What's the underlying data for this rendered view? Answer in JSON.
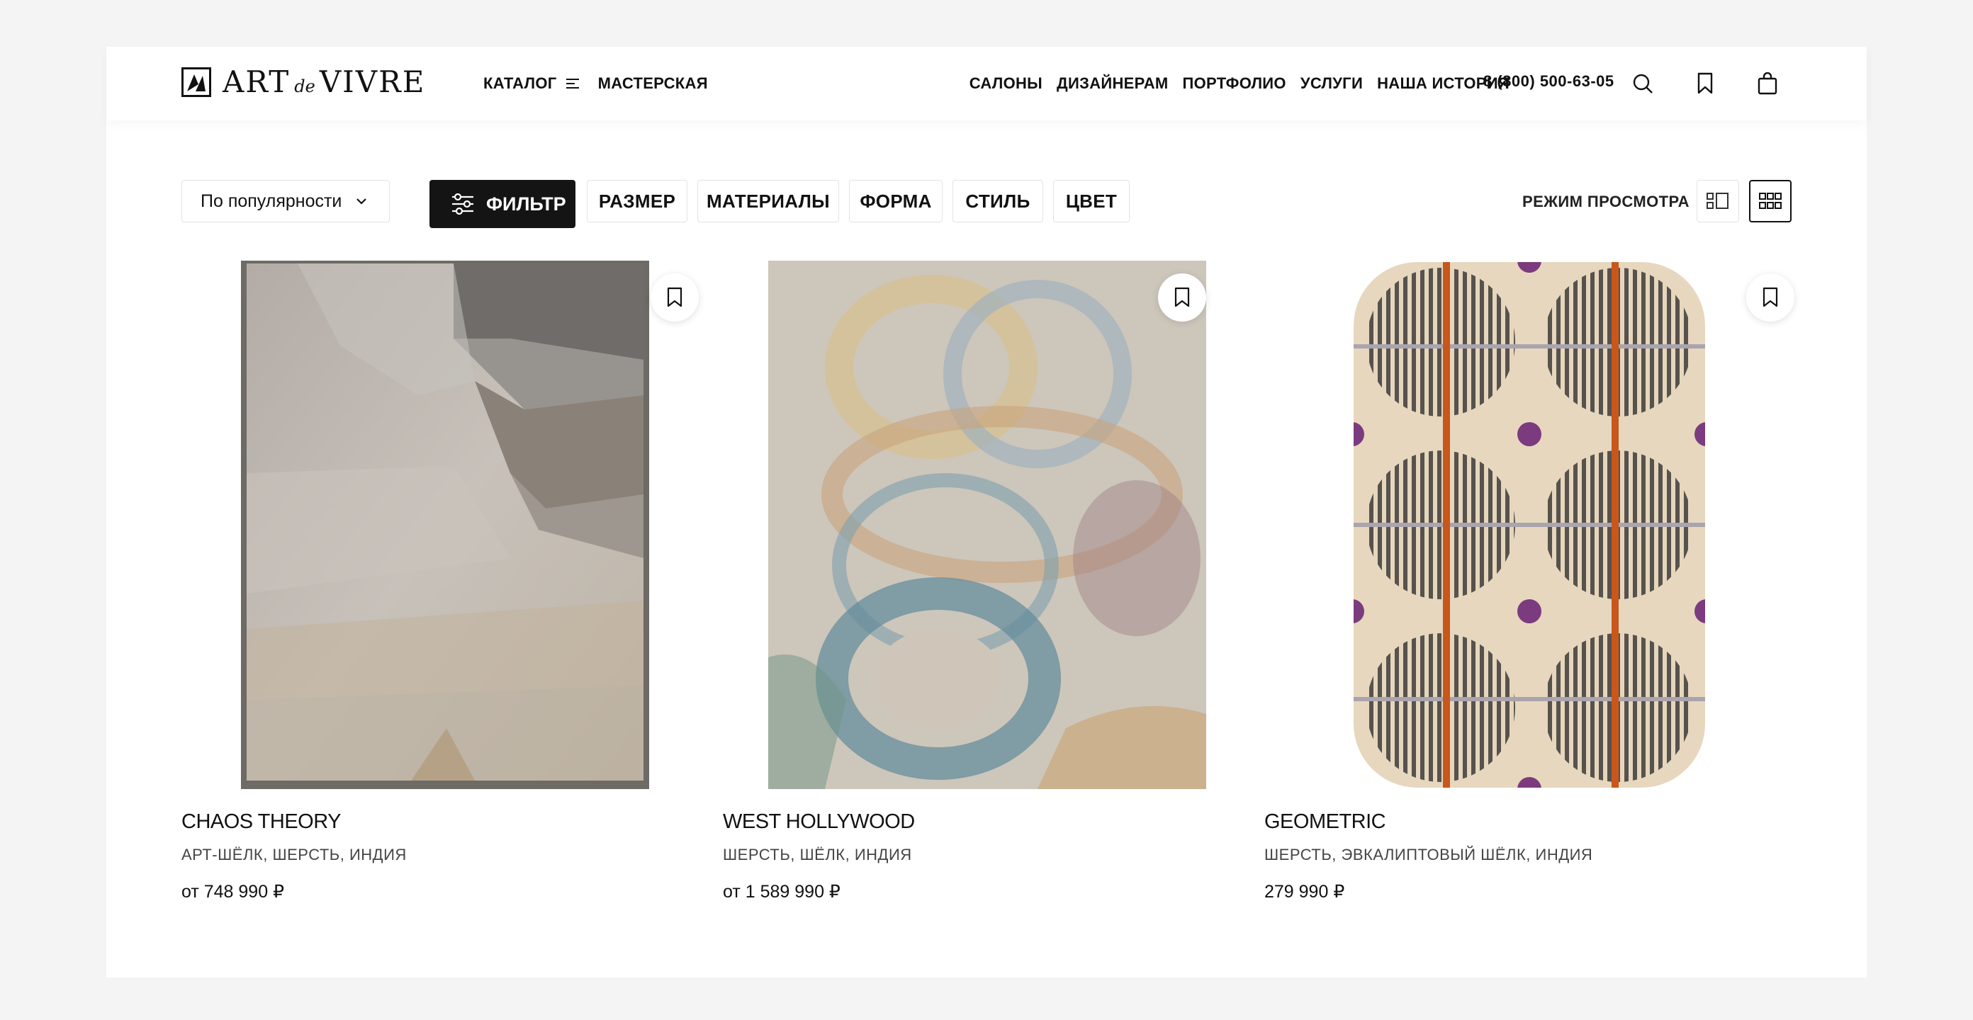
{
  "header": {
    "logo": {
      "art": "ART",
      "de": "de",
      "vivre": "VIVRE"
    },
    "catalog_label": "КАТАЛОГ",
    "workshop_label": "МАСТЕРСКАЯ",
    "nav": [
      "САЛОНЫ",
      "ДИЗАЙНЕРАМ",
      "ПОРТФОЛИО",
      "УСЛУГИ",
      "НАША ИСТОРИЯ"
    ],
    "phone": "8 (800) 500-63-05",
    "icons": [
      "search-icon",
      "bookmark-icon",
      "shopping-bag-icon"
    ]
  },
  "toolbar": {
    "sort_value": "По популярности",
    "filter_label": "ФИЛЬТР",
    "chips": [
      "РАЗМЕР",
      "МАТЕРИАЛЫ",
      "ФОРМА",
      "СТИЛЬ",
      "ЦВЕТ"
    ],
    "view_mode_label": "РЕЖИМ ПРОСМОТРА",
    "view_modes": [
      "list-view-icon",
      "grid-view-icon"
    ],
    "active_view": "grid-view-icon"
  },
  "products": [
    {
      "name": "CHAOS THEORY",
      "materials": "АРТ-ШЁЛК, ШЕРСТЬ, ИНДИЯ",
      "price": "от 748 990 ₽"
    },
    {
      "name": "WEST HOLLYWOOD",
      "materials": "ШЕРСТЬ, ШЁЛК, ИНДИЯ",
      "price": "от 1 589 990 ₽"
    },
    {
      "name": "GEOMETRIC",
      "materials": "ШЕРСТЬ, ЭВКАЛИПТОВЫЙ ШЁЛК, ИНДИЯ",
      "price": "279 990 ₽"
    }
  ],
  "colors": {
    "background": "#f3f4f3",
    "panel": "#ffffff",
    "primary_button": "#141414",
    "text": "#111111"
  }
}
